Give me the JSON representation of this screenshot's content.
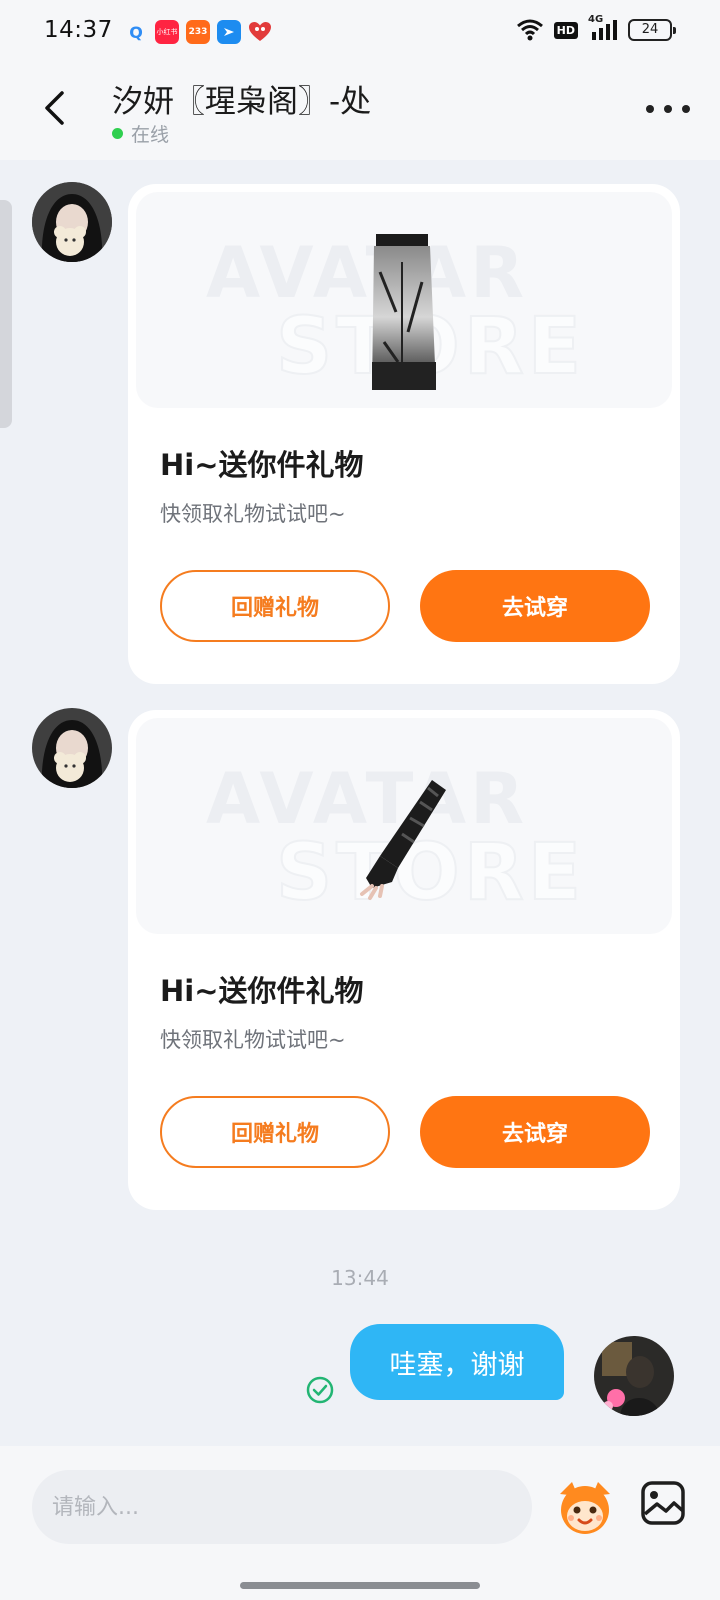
{
  "status_bar": {
    "time": "14:37",
    "apps": [
      {
        "icon": "search-notification-icon",
        "label": "Q",
        "color": "#2f8df5"
      },
      {
        "icon": "xiaohongshu-notification-icon",
        "label": "小红书",
        "color": "#ff2442"
      },
      {
        "icon": "app-233-notification-icon",
        "label": "233",
        "color": "#ff6a1a"
      },
      {
        "icon": "bird-app-notification-icon",
        "label": "",
        "color": "#1d8cf0"
      },
      {
        "icon": "heart-app-notification-icon",
        "label": "",
        "color": "#e23b3b"
      }
    ],
    "hd_label": "HD",
    "network_label": "4G",
    "battery": "24"
  },
  "header": {
    "title": "汐妍〖瑆枭阁〗-处",
    "status": "在线"
  },
  "messages": [
    {
      "type": "gift",
      "watermark_top": "AVATAR",
      "watermark_bottom": "STORE",
      "title": "Hi~送你件礼物",
      "subtitle": "快领取礼物试试吧~",
      "return_gift_label": "回赠礼物",
      "try_on_label": "去试穿",
      "item_icon": "black-pants-item"
    },
    {
      "type": "gift",
      "watermark_top": "AVATAR",
      "watermark_bottom": "STORE",
      "title": "Hi~送你件礼物",
      "subtitle": "快领取礼物试试吧~",
      "return_gift_label": "回赠礼物",
      "try_on_label": "去试穿",
      "item_icon": "black-arm-sleeve-item"
    }
  ],
  "timestamp": "13:44",
  "outgoing": {
    "text": "哇塞，谢谢",
    "status_icon": "read-check-icon"
  },
  "input": {
    "placeholder": "请输入..."
  },
  "colors": {
    "accent_orange": "#ff7512",
    "bubble_blue": "#2fb6f5",
    "online_green": "#2fcf4f",
    "read_green": "#22b573"
  }
}
